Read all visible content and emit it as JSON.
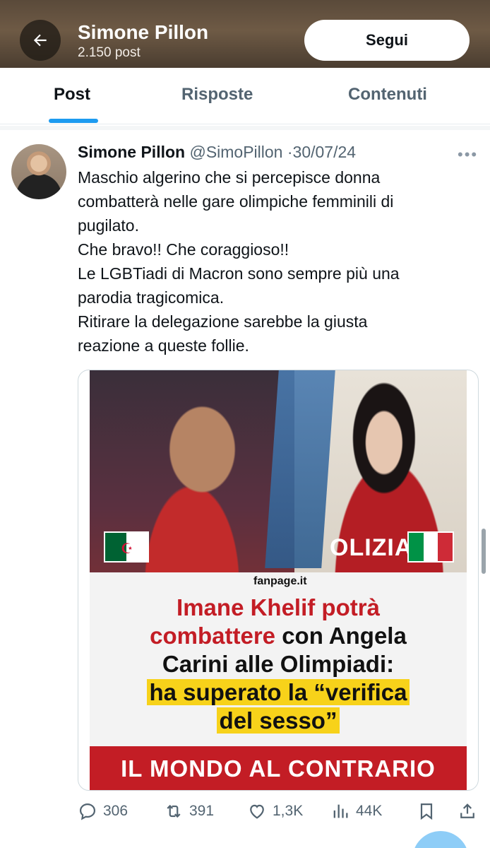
{
  "header": {
    "title": "Simone Pillon",
    "post_count": "2.150 post",
    "follow_label": "Segui"
  },
  "tabs": [
    {
      "label": "Post",
      "active": true
    },
    {
      "label": "Risposte",
      "active": false
    },
    {
      "label": "Contenuti",
      "active": false
    }
  ],
  "tweet": {
    "author_name": "Simone Pillon",
    "handle": "@SimoPillon",
    "separator": "·",
    "date": "30/07/24",
    "more": "•••",
    "text_lines": [
      "Maschio algerino che si percepisce donna",
      "combatterà nelle gare olimpiche femminili di",
      "pugilato.",
      "Che bravo!! Che coraggioso!!",
      "Le LGBTiadi di Macron sono sempre più una",
      "parodia tragicomica.",
      "Ritirare la delegazione sarebbe la giusta",
      "reazione a queste follie."
    ],
    "media": {
      "source": "fanpage.it",
      "polizia_text": "OLIZIA",
      "headline_red_1": "Imane Khelif potrà",
      "headline_red_2": "combattere",
      "headline_black_2": " con Angela",
      "headline_black_3": "Carini alle Olimpiadi:",
      "headline_hl_1": "ha superato la “verifica",
      "headline_hl_2": "del sesso”",
      "bottom_banner": "IL MONDO AL CONTRARIO"
    },
    "actions": {
      "replies": "306",
      "reposts": "391",
      "likes": "1,3K",
      "views": "44K"
    }
  },
  "colors": {
    "accent": "#1d9bf0",
    "headline_red": "#c31d25",
    "highlight_yellow": "#f7d21a",
    "muted": "#536471"
  }
}
